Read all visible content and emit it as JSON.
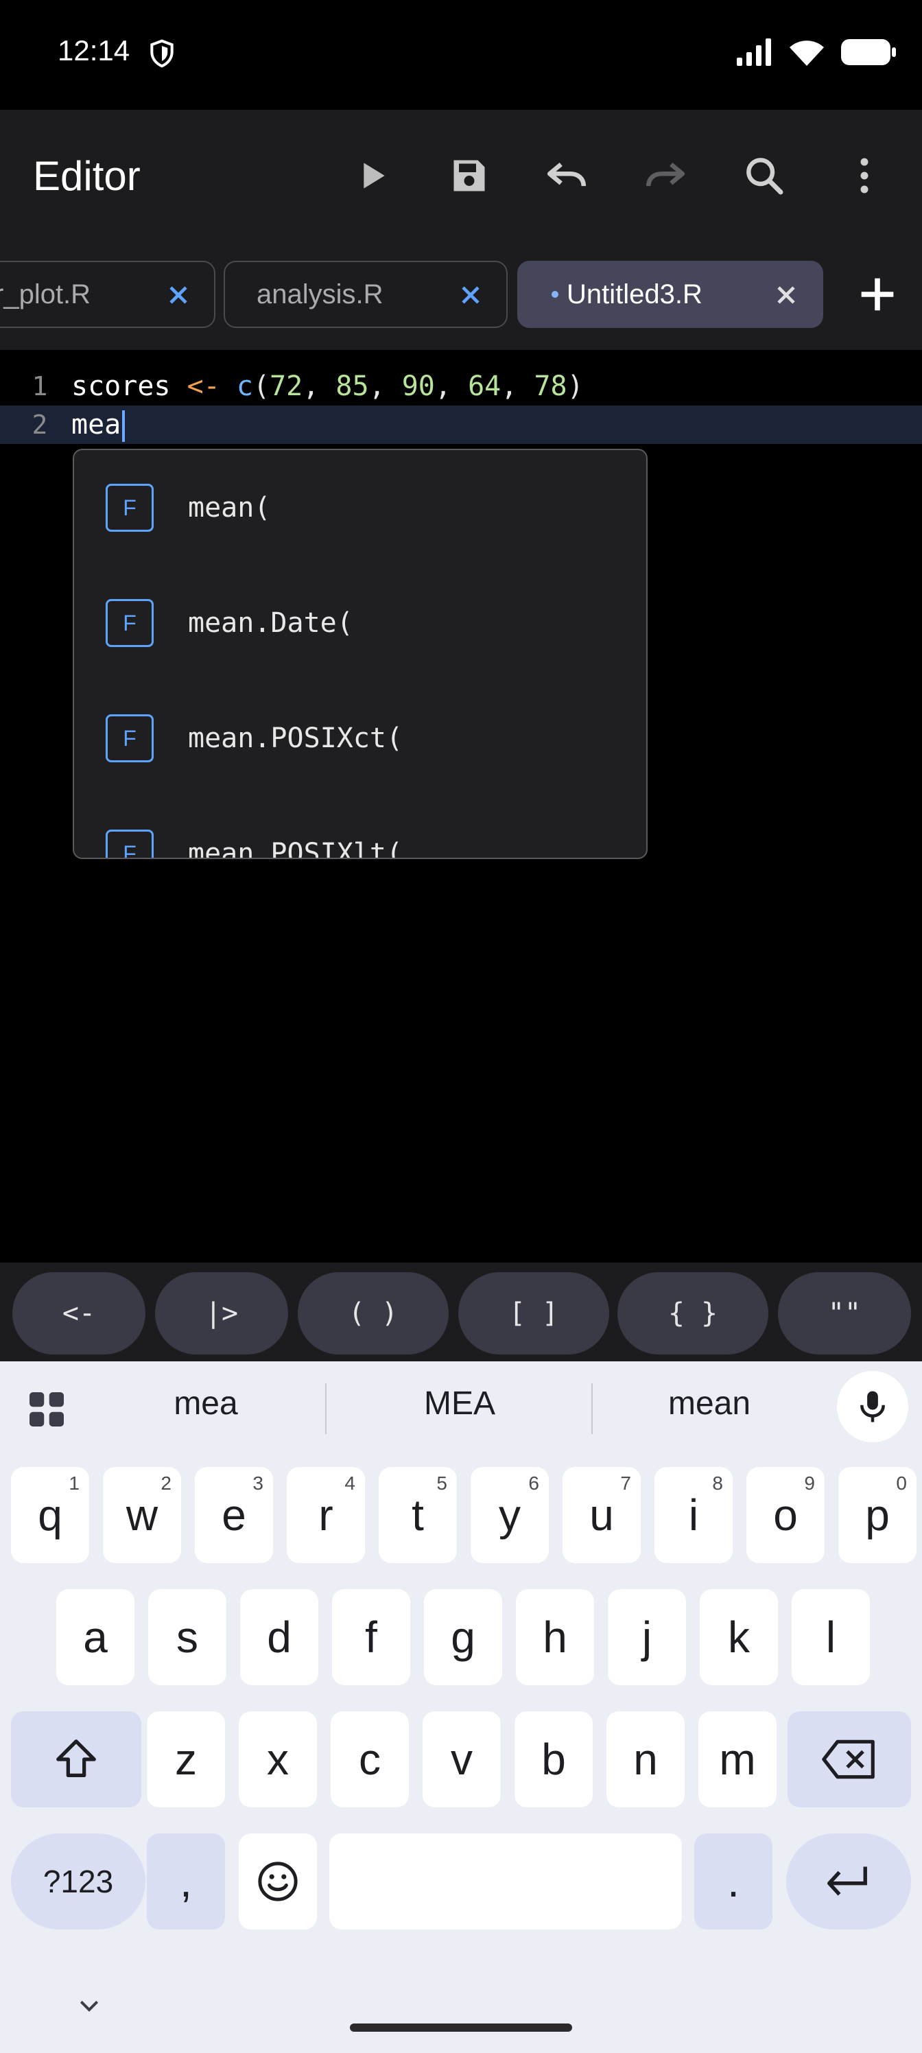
{
  "status_bar": {
    "time": "12:14",
    "icons": [
      "shield-icon",
      "signal-icon",
      "wifi-icon",
      "battery-icon"
    ]
  },
  "app_bar": {
    "title": "Editor",
    "actions": [
      "run-icon",
      "save-icon",
      "undo-icon",
      "redo-icon",
      "search-icon",
      "more-vert-icon"
    ]
  },
  "tabs": [
    {
      "label": "r_plot.R",
      "active": false
    },
    {
      "label": "analysis.R",
      "active": false
    },
    {
      "label": "Untitled3.R",
      "active": true,
      "modified": true
    }
  ],
  "editor": {
    "lines": [
      {
        "number": "1",
        "tokens": [
          {
            "t": "scores ",
            "k": "id"
          },
          {
            "t": "<-",
            "k": "op"
          },
          {
            "t": " ",
            "k": "id"
          },
          {
            "t": "c",
            "k": "fn"
          },
          {
            "t": "(",
            "k": "punc"
          },
          {
            "t": "72",
            "k": "num"
          },
          {
            "t": ", ",
            "k": "punc"
          },
          {
            "t": "85",
            "k": "num"
          },
          {
            "t": ", ",
            "k": "punc"
          },
          {
            "t": "90",
            "k": "num"
          },
          {
            "t": ", ",
            "k": "punc"
          },
          {
            "t": "64",
            "k": "num"
          },
          {
            "t": ", ",
            "k": "punc"
          },
          {
            "t": "78",
            "k": "num"
          },
          {
            "t": ")",
            "k": "punc"
          }
        ]
      },
      {
        "number": "2",
        "text": "mea",
        "current": true
      }
    ]
  },
  "autocomplete": {
    "items": [
      {
        "badge": "F",
        "label": "mean("
      },
      {
        "badge": "F",
        "label": "mean.Date("
      },
      {
        "badge": "F",
        "label": "mean.POSIXct("
      },
      {
        "badge": "F",
        "label": "mean.POSIXlt("
      }
    ]
  },
  "shortcuts": [
    "<-",
    "|>",
    "( )",
    "[ ]",
    "{ }",
    "\"\""
  ],
  "keyboard": {
    "suggestions": [
      "mea",
      "MEA",
      "mean"
    ],
    "row1": [
      {
        "k": "q",
        "h": "1"
      },
      {
        "k": "w",
        "h": "2"
      },
      {
        "k": "e",
        "h": "3"
      },
      {
        "k": "r",
        "h": "4"
      },
      {
        "k": "t",
        "h": "5"
      },
      {
        "k": "y",
        "h": "6"
      },
      {
        "k": "u",
        "h": "7"
      },
      {
        "k": "i",
        "h": "8"
      },
      {
        "k": "o",
        "h": "9"
      },
      {
        "k": "p",
        "h": "0"
      }
    ],
    "row2": [
      "a",
      "s",
      "d",
      "f",
      "g",
      "h",
      "j",
      "k",
      "l"
    ],
    "row3": [
      "z",
      "x",
      "c",
      "v",
      "b",
      "n",
      "m"
    ],
    "symbols_label": "?123",
    "comma": ",",
    "period": "."
  },
  "colors": {
    "accent": "#5fa3ff",
    "current_line": "#1b2336",
    "operator": "#f0a050",
    "number": "#b8e39a"
  }
}
